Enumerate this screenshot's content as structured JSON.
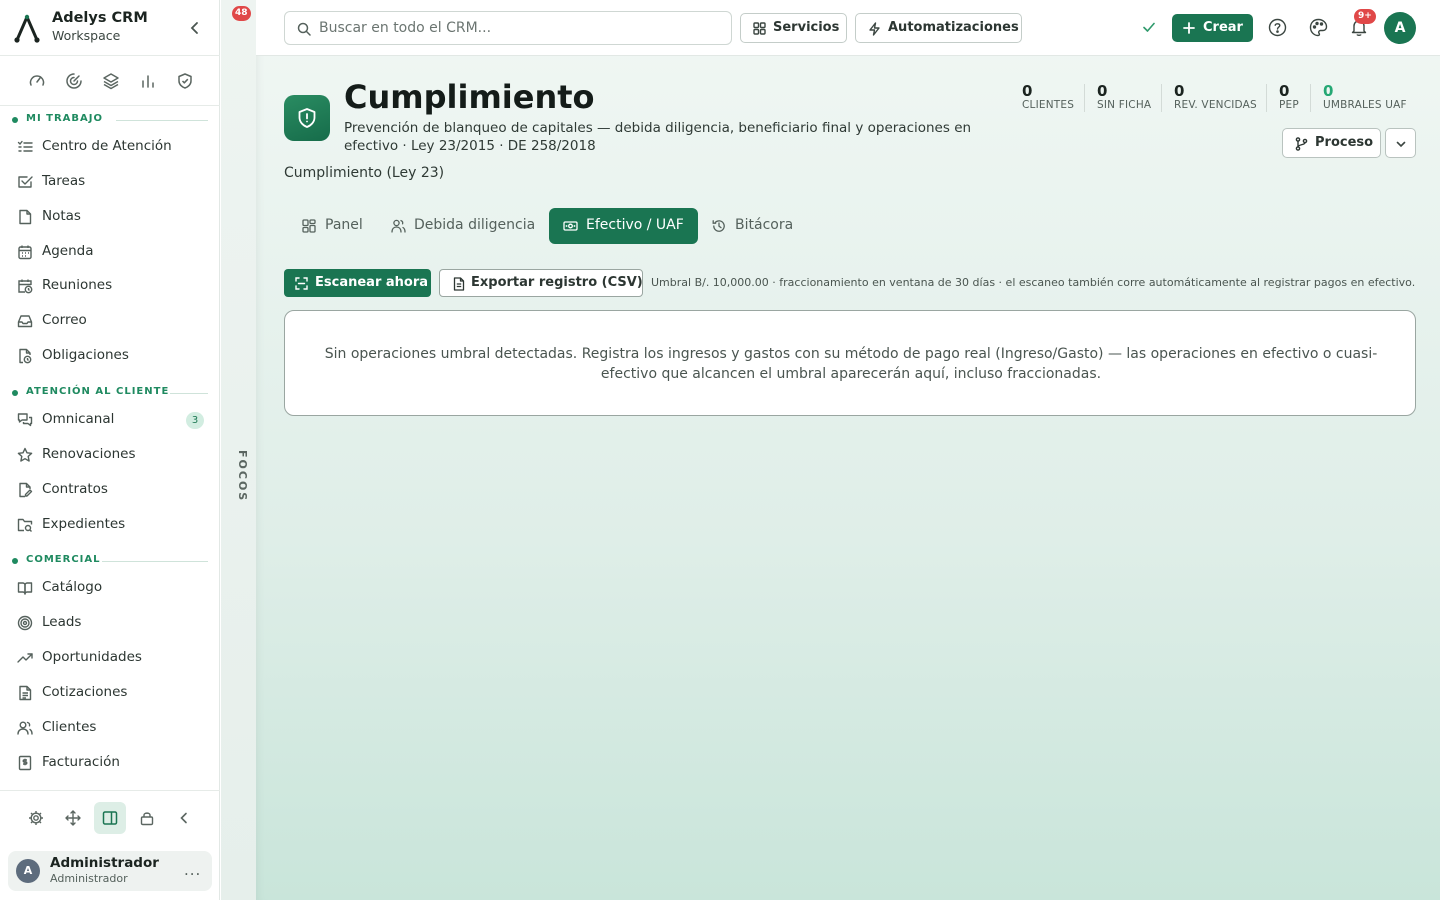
{
  "app": {
    "name": "Adelys CRM",
    "workspace": "Workspace"
  },
  "sidebar": {
    "sections": [
      {
        "title": "MI TRABAJO",
        "items": [
          {
            "label": "Centro de Atención",
            "icon": "list-check-icon"
          },
          {
            "label": "Tareas",
            "icon": "checkbox-icon"
          },
          {
            "label": "Notas",
            "icon": "note-icon"
          },
          {
            "label": "Agenda",
            "icon": "calendar-icon"
          },
          {
            "label": "Reuniones",
            "icon": "calendar-clock-icon"
          },
          {
            "label": "Correo",
            "icon": "inbox-icon"
          },
          {
            "label": "Obligaciones",
            "icon": "file-clock-icon"
          }
        ]
      },
      {
        "title": "ATENCIÓN AL CLIENTE",
        "items": [
          {
            "label": "Omnicanal",
            "icon": "messages-icon",
            "badge": "3"
          },
          {
            "label": "Renovaciones",
            "icon": "star-icon"
          },
          {
            "label": "Contratos",
            "icon": "file-signature-icon"
          },
          {
            "label": "Expedientes",
            "icon": "folder-search-icon"
          }
        ]
      },
      {
        "title": "COMERCIAL",
        "items": [
          {
            "label": "Catálogo",
            "icon": "book-open-icon"
          },
          {
            "label": "Leads",
            "icon": "target-icon"
          },
          {
            "label": "Oportunidades",
            "icon": "trending-up-icon"
          },
          {
            "label": "Cotizaciones",
            "icon": "file-text-icon"
          },
          {
            "label": "Clientes",
            "icon": "users-icon"
          },
          {
            "label": "Facturación",
            "icon": "receipt-icon"
          }
        ]
      }
    ],
    "quick_icons": [
      "gauge-icon",
      "radar-icon",
      "layers-icon",
      "bar-chart-icon",
      "shield-check-icon"
    ],
    "footer_icons": [
      "settings-icon",
      "move-icon",
      "panel-icon",
      "lock-icon",
      "chevron-left-icon"
    ],
    "user": {
      "initial": "A",
      "name": "Administrador",
      "role": "Administrador",
      "more": "..."
    }
  },
  "focos": {
    "label": "FOCOS",
    "badge": "48"
  },
  "topbar": {
    "search_placeholder": "Buscar en todo el CRM...",
    "servicios": "Servicios",
    "automatizaciones": "Automatizaciones",
    "crear": "Crear",
    "notif_badge": "9+",
    "avatar_initial": "A"
  },
  "page": {
    "title": "Cumplimiento",
    "subtitle": "Prevención de blanqueo de capitales — debida diligencia, beneficiario final y operaciones en efectivo · Ley 23/2015 · DE 258/2018",
    "context": "Cumplimiento (Ley 23)",
    "stats": [
      {
        "value": "0",
        "label": "CLIENTES"
      },
      {
        "value": "0",
        "label": "SIN FICHA"
      },
      {
        "value": "0",
        "label": "REV. VENCIDAS"
      },
      {
        "value": "0",
        "label": "PEP"
      },
      {
        "value": "0",
        "label": "UMBRALES UAF",
        "accent": true
      }
    ],
    "process_label": "Proceso",
    "tabs": [
      {
        "label": "Panel",
        "icon": "grid-icon"
      },
      {
        "label": "Debida diligencia",
        "icon": "users-icon"
      },
      {
        "label": "Efectivo / UAF",
        "icon": "banknote-icon",
        "active": true
      },
      {
        "label": "Bitácora",
        "icon": "history-icon"
      }
    ],
    "actions": {
      "scan": "Escanear ahora",
      "export": "Exportar registro (CSV)",
      "hint": "Umbral B/. 10,000.00 · fraccionamiento en ventana de 30 días · el escaneo también corre automáticamente al registrar pagos en efectivo."
    },
    "empty_message": "Sin operaciones umbral detectadas. Registra los ingresos y gastos con su método de pago real (Ingreso/Gasto) — las operaciones en efectivo o cuasi-efectivo que alcancen el umbral aparecerán aquí, incluso fraccionadas."
  },
  "colors": {
    "brand": "#1a7552",
    "accent": "#25a874",
    "badge": "#e04848"
  }
}
